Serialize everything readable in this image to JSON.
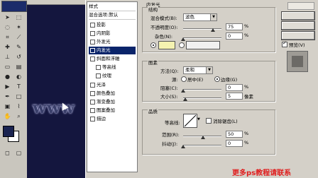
{
  "styles_panel": {
    "items": [
      {
        "label": "样式",
        "checkbox": false
      },
      {
        "label": "混合选项:默认",
        "checkbox": false
      },
      {
        "label": "投影",
        "checkbox": true
      },
      {
        "label": "内阴影",
        "checkbox": true
      },
      {
        "label": "外发光",
        "checkbox": true
      },
      {
        "label": "内发光",
        "checkbox": true,
        "selected": true
      },
      {
        "label": "斜面和浮雕",
        "checkbox": true
      },
      {
        "label": "等高线",
        "checkbox": true
      },
      {
        "label": "纹理",
        "checkbox": true
      },
      {
        "label": "光泽",
        "checkbox": true
      },
      {
        "label": "颜色叠加",
        "checkbox": true
      },
      {
        "label": "渐变叠加",
        "checkbox": true
      },
      {
        "label": "图案叠加",
        "checkbox": true
      },
      {
        "label": "描边",
        "checkbox": true
      }
    ]
  },
  "inner_glow": {
    "title": "内发光",
    "structure": {
      "title": "结构",
      "blend_mode_label": "混合模式(B):",
      "blend_mode_value": "滤色",
      "opacity_label": "不透明度(O):",
      "opacity_value": "75",
      "opacity_unit": "%",
      "noise_label": "杂色(N):",
      "noise_value": "0",
      "noise_unit": "%"
    },
    "elements": {
      "title": "图素",
      "method_label": "方法(Q):",
      "method_value": "柔和",
      "source_label": "源:",
      "source_center": "居中(E)",
      "source_edge": "边缘(G)",
      "choke_label": "阻塞(C):",
      "choke_value": "0",
      "choke_unit": "%",
      "size_label": "大小(S):",
      "size_value": "5",
      "size_unit": "像素"
    },
    "quality": {
      "title": "品质",
      "contour_label": "等高线:",
      "antialias_label": "消除锯齿(L)",
      "range_label": "范围(R):",
      "range_value": "50",
      "range_unit": "%",
      "jitter_label": "抖动(J):",
      "jitter_value": "0",
      "jitter_unit": "%"
    }
  },
  "right_panel": {
    "preview_label": "预览(V)",
    "preview_checked": true
  },
  "canvas_text": "www",
  "banner": "更多ps教程请联系"
}
